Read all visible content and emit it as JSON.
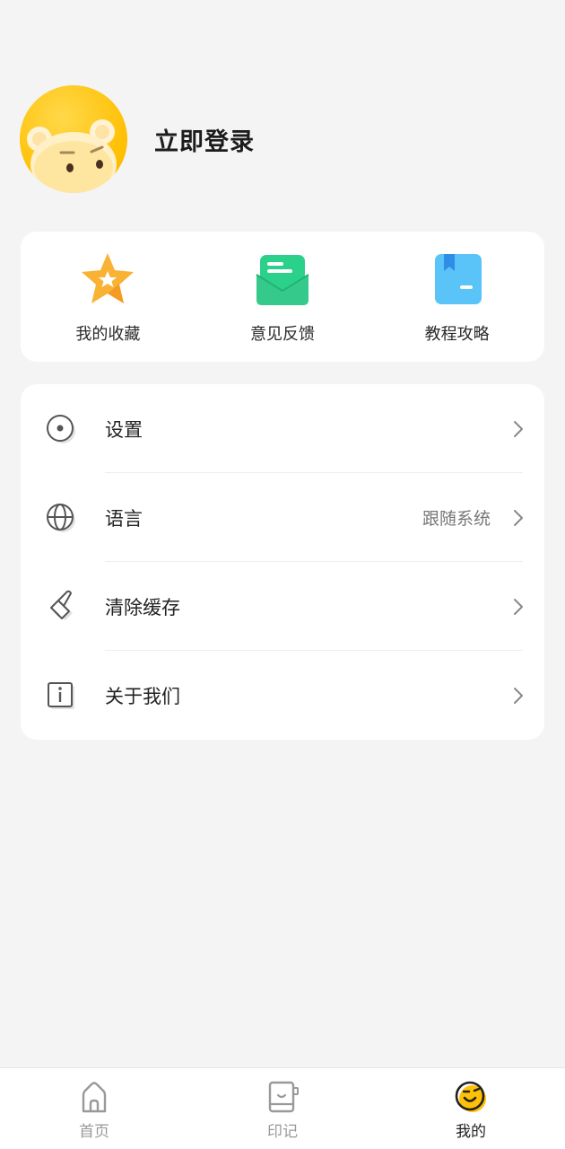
{
  "profile": {
    "login_label": "立即登录"
  },
  "quick_actions": [
    {
      "label": "我的收藏",
      "icon": "star-icon"
    },
    {
      "label": "意见反馈",
      "icon": "feedback-mail-icon"
    },
    {
      "label": "教程攻略",
      "icon": "guide-book-icon"
    }
  ],
  "menu": [
    {
      "label": "设置",
      "value": "",
      "icon": "settings-icon"
    },
    {
      "label": "语言",
      "value": "跟随系统",
      "icon": "globe-icon"
    },
    {
      "label": "清除缓存",
      "value": "",
      "icon": "brush-icon"
    },
    {
      "label": "关于我们",
      "value": "",
      "icon": "info-icon"
    }
  ],
  "tabs": [
    {
      "label": "首页",
      "icon": "home-icon",
      "active": false
    },
    {
      "label": "印记",
      "icon": "notebook-icon",
      "active": false
    },
    {
      "label": "我的",
      "icon": "profile-face-icon",
      "active": true
    }
  ],
  "colors": {
    "background": "#f4f4f4",
    "card": "#ffffff",
    "avatar_yellow": "#ffc107",
    "star_orange": "#f7a62b",
    "feedback_green": "#2bd18a",
    "guide_blue": "#5ac3f7"
  }
}
